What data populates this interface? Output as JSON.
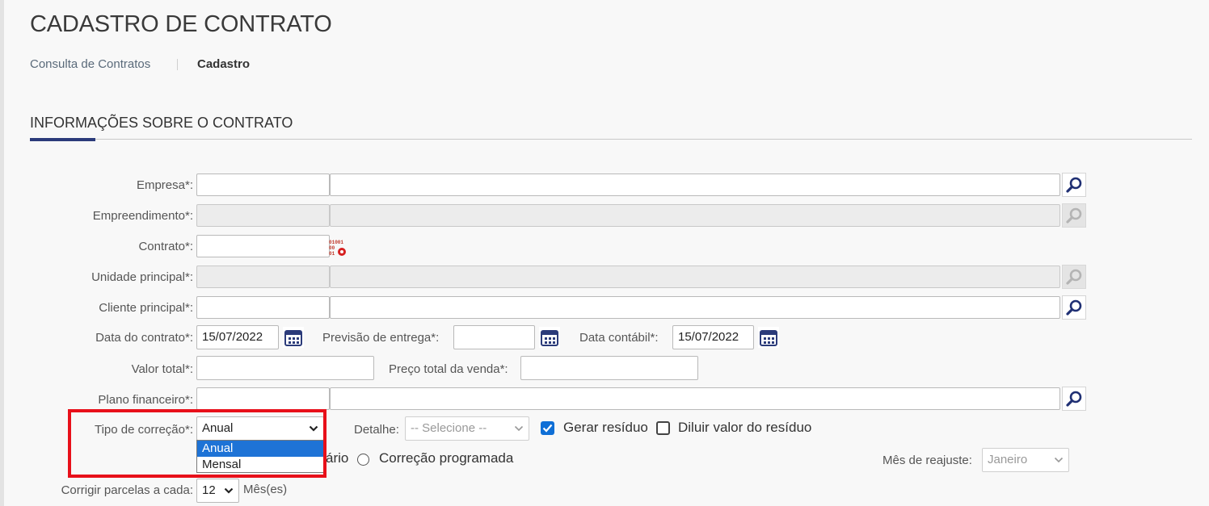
{
  "page": {
    "title": "CADASTRO DE CONTRATO"
  },
  "breadcrumb": {
    "link": "Consulta de Contratos",
    "current": "Cadastro"
  },
  "section": {
    "title": "INFORMAÇÕES SOBRE O CONTRATO"
  },
  "form": {
    "empresa": {
      "label": "Empresa*:",
      "code": "",
      "name": ""
    },
    "empreendimento": {
      "label": "Empreendimento*:",
      "code": "",
      "name": ""
    },
    "contrato": {
      "label": "Contrato*:",
      "value": "",
      "generator_icon_text": "01001\n00\n01"
    },
    "unidade_principal": {
      "label": "Unidade principal*:",
      "code": "",
      "name": ""
    },
    "cliente_principal": {
      "label": "Cliente principal*:",
      "code": "",
      "name": ""
    },
    "data_contrato": {
      "label": "Data do contrato*:",
      "value": "15/07/2022"
    },
    "previsao_entrega": {
      "label": "Previsão de entrega*:",
      "value": ""
    },
    "data_contabil": {
      "label": "Data contábil*:",
      "value": "15/07/2022"
    },
    "valor_total": {
      "label": "Valor total*:",
      "value": ""
    },
    "preco_total_venda": {
      "label": "Preço total da venda*:",
      "value": ""
    },
    "plano_financeiro": {
      "label": "Plano financeiro*:",
      "code": "",
      "name": ""
    },
    "tipo_correcao": {
      "label": "Tipo de correção*:",
      "value": "Anual",
      "options": [
        "Anual",
        "Mensal"
      ],
      "highlighted": "Anual"
    },
    "detalhe": {
      "label": "Detalhe:",
      "placeholder": "-- Selecione --"
    },
    "gerar_residuo": {
      "label": "Gerar resíduo",
      "checked": true
    },
    "diluir_residuo": {
      "label": "Diluir valor do resíduo",
      "checked": false
    },
    "radio_partial": "ário",
    "correcao_programada": {
      "label": "Correção programada"
    },
    "mes_reajuste": {
      "label": "Mês de reajuste:",
      "value": "Janeiro"
    },
    "corrigir_parcelas": {
      "label": "Corrigir parcelas a cada:",
      "value": "12",
      "unit": "Mês(es)"
    }
  },
  "colors": {
    "accent": "#2b3b7a",
    "highlight": "#1e73d6",
    "annotation": "#e8101a"
  }
}
